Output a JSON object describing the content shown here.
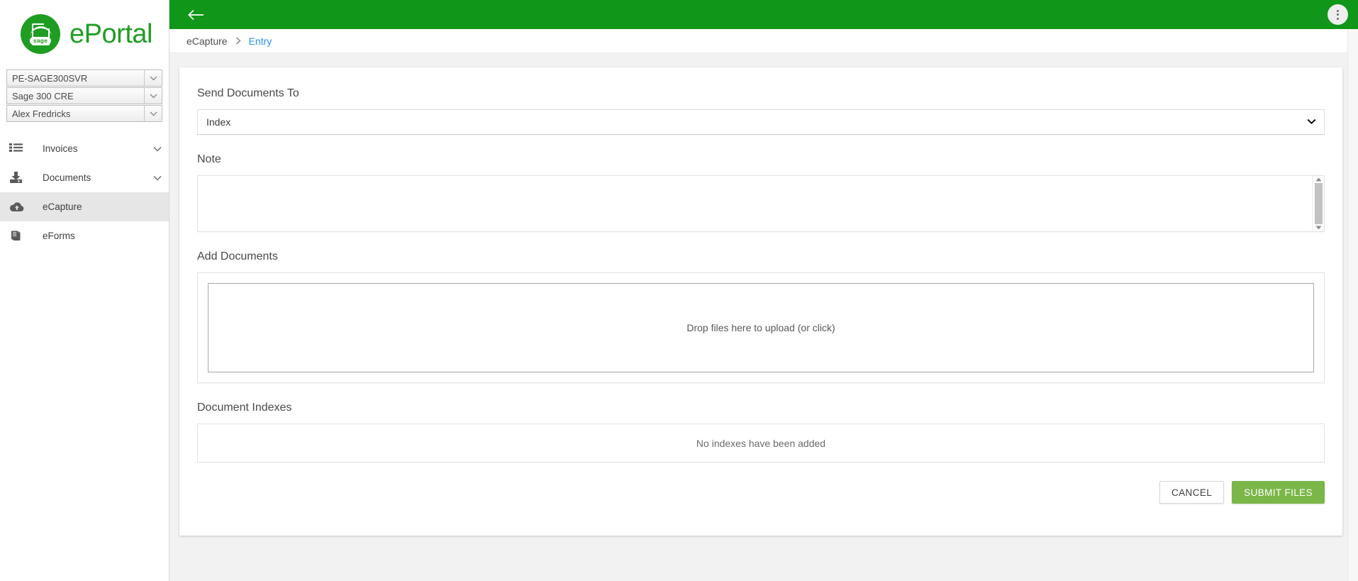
{
  "brand": {
    "name": "ePortal",
    "logo_text": "sage",
    "logo_icon": "sage-document-icon"
  },
  "sidebar": {
    "selectors": [
      {
        "value": "PE-SAGE300SVR",
        "icon": "chevron-down-icon"
      },
      {
        "value": "Sage 300 CRE",
        "icon": "chevron-down-icon"
      },
      {
        "value": "Alex Fredricks",
        "icon": "chevron-down-icon"
      }
    ],
    "items": [
      {
        "label": "Invoices",
        "icon": "list-icon",
        "expandable": true,
        "active": false
      },
      {
        "label": "Documents",
        "icon": "download-tray-icon",
        "expandable": true,
        "active": false
      },
      {
        "label": "eCapture",
        "icon": "cloud-upload-icon",
        "expandable": false,
        "active": true
      },
      {
        "label": "eForms",
        "icon": "book-icon",
        "expandable": false,
        "active": false
      }
    ]
  },
  "topbar": {
    "back_icon": "arrow-left-icon",
    "menu_icon": "kebab-menu-icon",
    "background_color": "#109618"
  },
  "breadcrumb": {
    "root": "eCapture",
    "separator": "›",
    "current": "Entry",
    "current_color": "#2a8fef"
  },
  "form": {
    "send_documents_to": {
      "label": "Send Documents To",
      "selected": "Index",
      "chevron": "chevron-down-icon"
    },
    "note": {
      "label": "Note",
      "value": "",
      "placeholder": ""
    },
    "add_documents": {
      "label": "Add Documents",
      "dropzone_text": "Drop files here to upload (or click)"
    },
    "document_indexes": {
      "label": "Document Indexes",
      "empty_text": "No indexes have been added"
    },
    "buttons": {
      "cancel": "CANCEL",
      "submit": "SUBMIT FILES",
      "submit_color": "#7ab648"
    }
  }
}
